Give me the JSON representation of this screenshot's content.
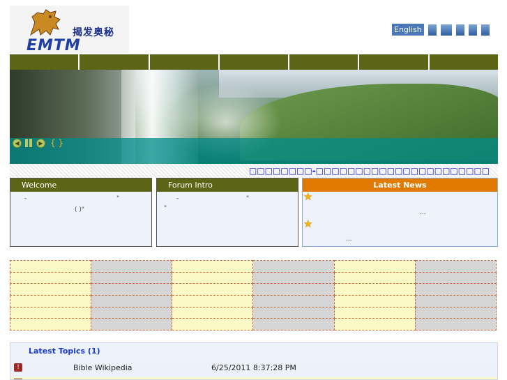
{
  "logo": {
    "chinese_text": "揭发奥秘",
    "english_text": "EMTM"
  },
  "language": {
    "english_label": "English"
  },
  "navbar": {
    "item_count": 7
  },
  "banner": {
    "braces": "{ }"
  },
  "marquee": {
    "text": "□□□□□□□□-□□□□□□□□□□□□□□□□□□□□□□"
  },
  "welcome": {
    "title": "Welcome",
    "line1_a": "-",
    "line1_b": "\"",
    "line2": "( )\""
  },
  "forum": {
    "title": "Forum Intro",
    "line1_a": "-",
    "line1_b": "\"",
    "line2": "\""
  },
  "news": {
    "title": "Latest News",
    "ellipsis1": "...",
    "ellipsis2": "..."
  },
  "topics": {
    "title": "Latest Topics (1)",
    "rows": [
      {
        "name": "Bible Wikipedia",
        "date": "6/25/2011 8:37:28 PM"
      }
    ]
  }
}
